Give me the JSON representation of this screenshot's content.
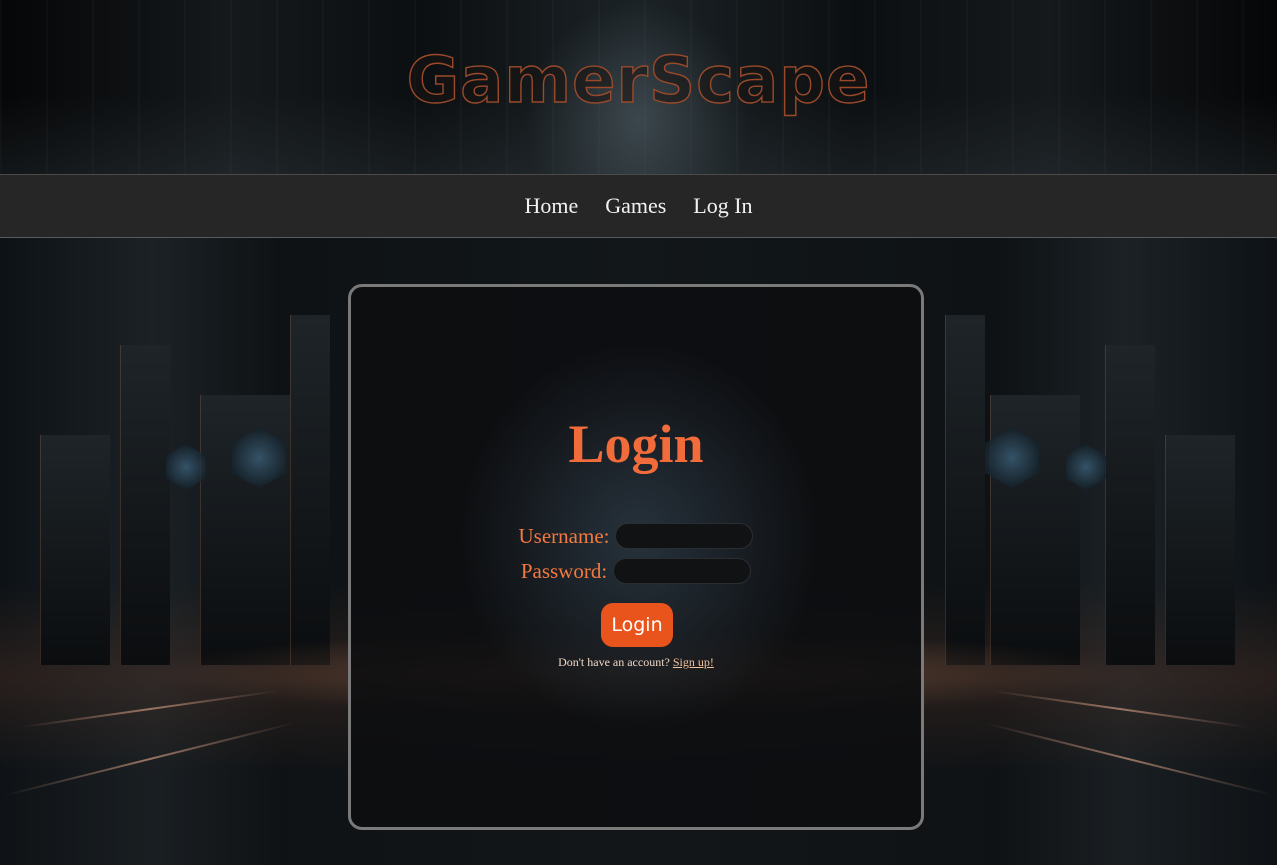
{
  "site": {
    "title": "GamerScape"
  },
  "nav": {
    "items": [
      {
        "label": "Home"
      },
      {
        "label": "Games"
      },
      {
        "label": "Log In"
      }
    ]
  },
  "login": {
    "heading": "Login",
    "username_label": "Username:",
    "username_value": "",
    "password_label": "Password:",
    "password_value": "",
    "submit_label": "Login",
    "signup_prompt": "Don't have an account?",
    "signup_link": "Sign up!"
  },
  "colors": {
    "accent": "#f26b3a",
    "button": "#e8541c",
    "nav_bg": "#262626",
    "card_border": "#7a7a7a"
  }
}
